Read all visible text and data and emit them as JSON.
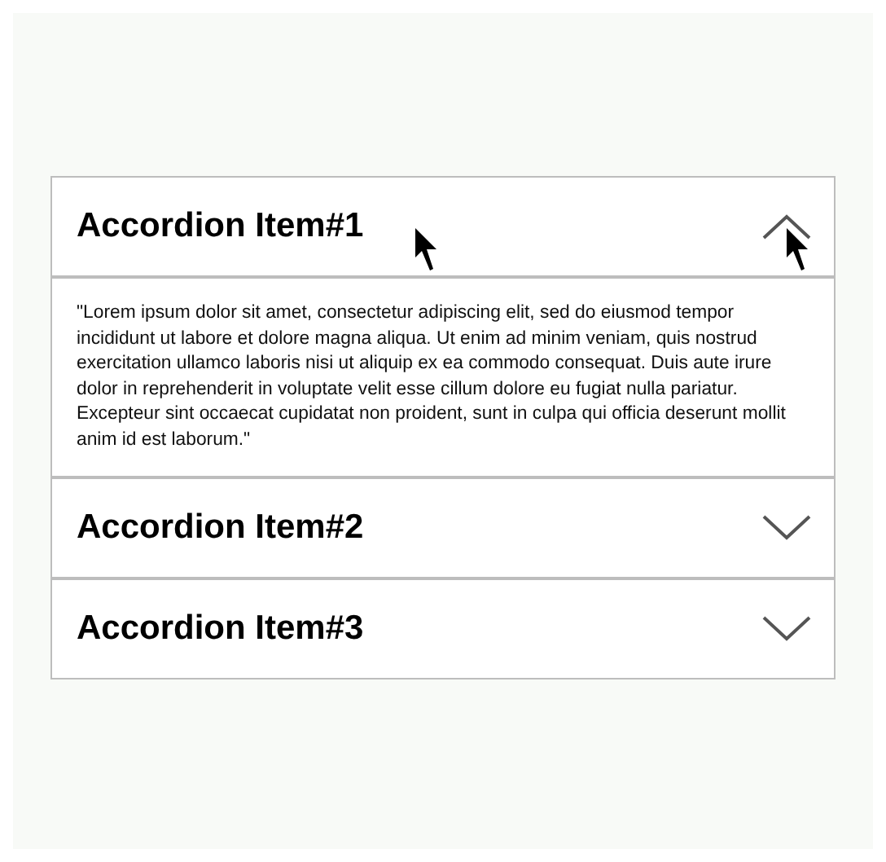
{
  "accordion": {
    "items": [
      {
        "title": "Accordion Item#1",
        "expanded": true,
        "body": "\"Lorem ipsum dolor sit amet, consectetur adipiscing elit, sed do eiusmod tempor incididunt ut labore et dolore magna aliqua. Ut enim ad minim veniam, quis nostrud exercitation ullamco laboris nisi ut aliquip ex ea commodo consequat. Duis aute irure dolor in reprehenderit in voluptate velit esse cillum dolore eu fugiat nulla pariatur. Excepteur sint occaecat cupidatat non proident, sunt in culpa qui officia deserunt mollit anim id est laborum.\""
      },
      {
        "title": "Accordion Item#2",
        "expanded": false
      },
      {
        "title": "Accordion Item#3",
        "expanded": false
      }
    ]
  }
}
